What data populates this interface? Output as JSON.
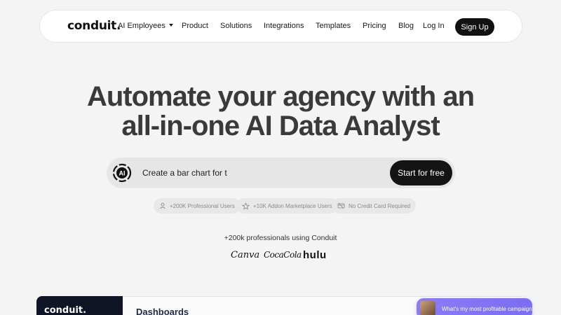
{
  "nav": {
    "logo": "conduit.",
    "links": {
      "ai_employees": "AI Employees",
      "product": "Product",
      "solutions": "Solutions",
      "integrations": "Integrations",
      "templates": "Templates",
      "pricing": "Pricing",
      "blog": "Blog",
      "login": "Log In"
    },
    "signup": "Sign Up"
  },
  "hero": {
    "title_line1": "Automate your agency with an",
    "title_line2": "all-in-one AI Data Analyst",
    "prompt_text": "Create a bar chart for t",
    "cta": "Start for free",
    "pills": {
      "users": "+200K Professional Users",
      "addon": "+10K Addon Marketplace Users",
      "credit": "No Credit Card Required"
    },
    "social_proof": "+200k professionals using Conduit",
    "brands": {
      "canva": "Canva",
      "coke": "CocaCola",
      "hulu": "hulu"
    }
  },
  "preview": {
    "logo": "conduit.",
    "heading": "Dashboards",
    "chat": "What's my most profitable campaign?"
  },
  "colors": {
    "primary": "#111111",
    "background": "#f4f4f4",
    "chat_accent": "#8b7cf7"
  },
  "icons": [
    "caret-down-icon",
    "ai-logo-icon",
    "user-icon",
    "star-icon",
    "card-icon"
  ]
}
